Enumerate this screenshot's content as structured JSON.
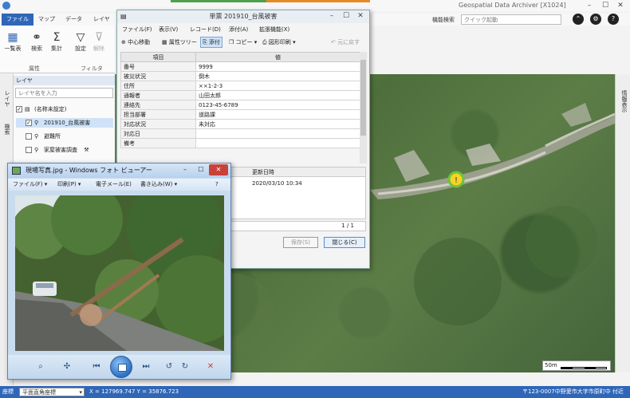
{
  "app": {
    "title": "Geospatial Data Archiver  [X1024]",
    "ribbon_tabs": [
      "ファイル",
      "マップ",
      "データ",
      "レイヤ"
    ],
    "function_search_label": "機能検索",
    "function_search_placeholder": "クイック起動"
  },
  "ribbon": {
    "buttons": [
      {
        "label": "一覧表",
        "icon": "table-list-icon",
        "glyph": "▦"
      },
      {
        "label": "検索",
        "icon": "binoculars-icon",
        "glyph": "⚭"
      },
      {
        "label": "集計",
        "icon": "sigma-icon",
        "glyph": "Σ"
      },
      {
        "label": "設定",
        "icon": "filter-icon",
        "glyph": "▽"
      },
      {
        "label": "解除",
        "icon": "filter-clear-icon",
        "glyph": "⊽"
      }
    ],
    "groups": [
      "属性",
      "フィルタ"
    ]
  },
  "side_tabs": [
    "レイヤ",
    "検索"
  ],
  "layer_panel": {
    "header": "レイヤ",
    "search_placeholder": "レイヤ名を入力",
    "tree": [
      {
        "label": "(名称未設定)",
        "checked": true,
        "level": 0
      },
      {
        "label": "201910_台風被害",
        "checked": true,
        "level": 1,
        "selected": true
      },
      {
        "label": "避難所",
        "checked": false,
        "level": 1
      },
      {
        "label": "家屋被害調査",
        "checked": false,
        "level": 1
      }
    ]
  },
  "map_side_tab": "情報表示",
  "scale": {
    "label": "50m"
  },
  "statusbar": {
    "left_label": "座標",
    "crs": "平面直角座標",
    "coords": "X = 127969.747  Y = 35876.723",
    "address": "〒123-0007中野愛市大字市原町中 付近"
  },
  "dialog": {
    "title": "単票 201910_台風被害",
    "menu": [
      "ファイル(F)",
      "表示(V)",
      "レコード(D)",
      "添付(A)",
      "拡張機能(X)"
    ],
    "toolbar": [
      "中心移動",
      "属性ツリー",
      "添付",
      "コピー ▾",
      "図形印刷 ▾",
      "元に戻す"
    ],
    "table_headers": [
      "項目",
      "値"
    ],
    "rows": [
      {
        "key": "番号",
        "value": "9999"
      },
      {
        "key": "被災状況",
        "value": "倒木"
      },
      {
        "key": "住所",
        "value": "××1-2-3"
      },
      {
        "key": "通報者",
        "value": "山田太郎"
      },
      {
        "key": "連絡先",
        "value": "0123-45-6789"
      },
      {
        "key": "担当部署",
        "value": "道路課"
      },
      {
        "key": "対応状況",
        "value": "未対応"
      },
      {
        "key": "対応日",
        "value": ""
      },
      {
        "key": "備考",
        "value": ""
      }
    ],
    "attachments": {
      "header": "更新日時",
      "date": "2020/03/10 10:34"
    },
    "pager": "1 / 1",
    "save_label": "保存(S)",
    "close_label": "閉じる(C)"
  },
  "viewer": {
    "title": "現場写真.jpg - Windows フォト ビューアー",
    "menu": [
      "ファイル(F) ▾",
      "印刷(P) ▾",
      "電子メール(E)",
      "書き込み(W) ▾"
    ],
    "help": "?"
  },
  "colors": {
    "accent": "#2f66b8",
    "marker": "#f5d328"
  }
}
